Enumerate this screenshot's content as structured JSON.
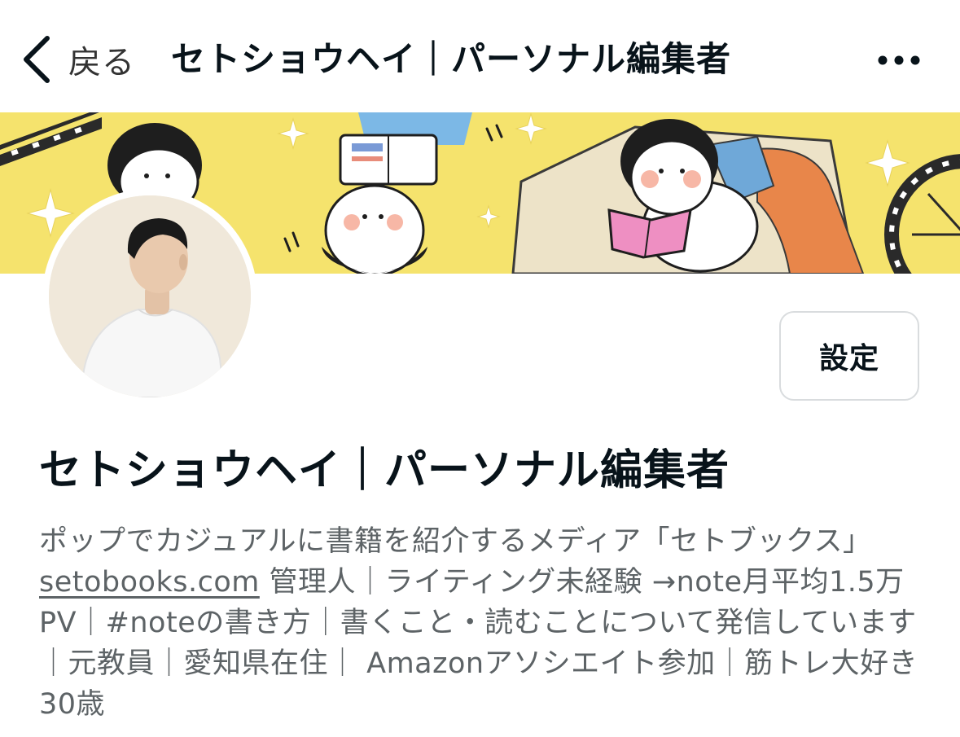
{
  "nav": {
    "back_label": "戻る",
    "title": "セトショウヘイ｜パーソナル編集者",
    "more_icon": "more-horizontal-icon"
  },
  "profile": {
    "name": "セトショウヘイ｜パーソナル編集者",
    "settings_label": "設定",
    "bio": {
      "part1": "ポップでカジュアルに書籍を紹介するメディア「セトブックス」",
      "link": "setobooks.com",
      "part2": " 管理人｜ライティング未経験 →note月平均1.5万PV｜#noteの書き方｜書くこと・読むことについて発信しています｜元教員｜愛知県在住｜ Amazonアソシエイト参加｜筋トレ大好き 30歳"
    }
  },
  "colors": {
    "cover_bg": "#f5e36d",
    "text_primary": "#08131a",
    "text_secondary": "#5d6366",
    "button_border": "#d9dcde"
  }
}
